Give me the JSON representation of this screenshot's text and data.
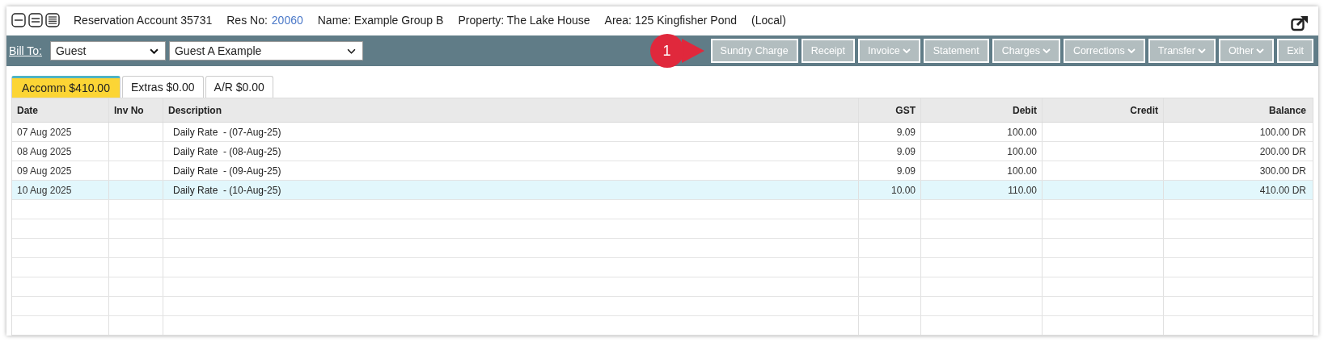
{
  "header": {
    "title": "Reservation Account 35731",
    "res_no_label": "Res No:",
    "res_no": "20060",
    "name": "Name: Example Group B",
    "property": "Property: The Lake House",
    "area": "Area: 125 Kingfisher Pond",
    "local": "(Local)"
  },
  "toolbar": {
    "bill_to_label": "Bill To:",
    "bill_type": "Guest",
    "bill_guest": "Guest A Example",
    "callout": {
      "label": "1"
    },
    "buttons": [
      {
        "label": "Sundry Charge",
        "has_menu": false
      },
      {
        "label": "Receipt",
        "has_menu": false
      },
      {
        "label": "Invoice",
        "has_menu": true
      },
      {
        "label": "Statement",
        "has_menu": false
      },
      {
        "label": "Charges",
        "has_menu": true
      },
      {
        "label": "Corrections",
        "has_menu": true
      },
      {
        "label": "Transfer",
        "has_menu": true
      },
      {
        "label": "Other",
        "has_menu": true
      },
      {
        "label": "Exit",
        "has_menu": false
      }
    ]
  },
  "tabs": [
    {
      "label": "Accomm $410.00",
      "selected": true
    },
    {
      "label": "Extras $0.00",
      "selected": false
    },
    {
      "label": "A/R $0.00",
      "selected": false
    }
  ],
  "table": {
    "columns": [
      "Date",
      "Inv No",
      "Description",
      "GST",
      "Debit",
      "Credit",
      "Balance"
    ],
    "rows": [
      {
        "selected": false,
        "cells": [
          "07 Aug 2025",
          "",
          "Daily Rate  - (07-Aug-25)",
          "9.09",
          "100.00",
          "",
          "100.00 DR"
        ]
      },
      {
        "selected": false,
        "cells": [
          "08 Aug 2025",
          "",
          "Daily Rate  - (08-Aug-25)",
          "9.09",
          "100.00",
          "",
          "200.00 DR"
        ]
      },
      {
        "selected": false,
        "cells": [
          "09 Aug 2025",
          "",
          "Daily Rate  - (09-Aug-25)",
          "9.09",
          "100.00",
          "",
          "300.00 DR"
        ]
      },
      {
        "selected": true,
        "cells": [
          "10 Aug 2025",
          "",
          "Daily Rate  - (10-Aug-25)",
          "10.00",
          "110.00",
          "",
          "410.00 DR"
        ]
      }
    ]
  }
}
